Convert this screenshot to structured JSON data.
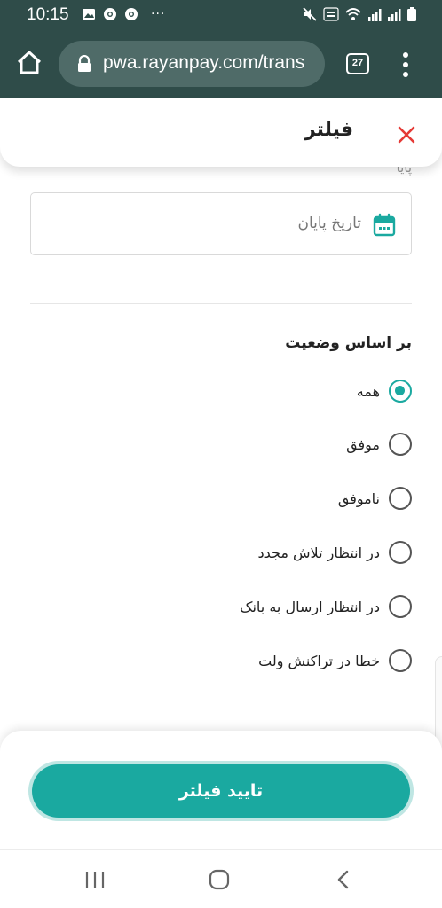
{
  "status_bar": {
    "time": "10:15",
    "left_icons": [
      "image-icon",
      "chrome-icon",
      "chrome-icon"
    ],
    "more": "···",
    "right_icons": [
      "mute-icon",
      "volte-icon",
      "wifi-icon",
      "signal-icon",
      "signal-icon",
      "battery-icon"
    ]
  },
  "browser": {
    "url": "pwa.rayanpay.com/trans",
    "tab_count": "27"
  },
  "header": {
    "title": "فیلتر",
    "peek_text": "پایا"
  },
  "date_field": {
    "placeholder": "تاریخ پایان"
  },
  "status_filter": {
    "title": "بر اساس وضعیت",
    "options": [
      {
        "label": "همه",
        "selected": true
      },
      {
        "label": "موفق",
        "selected": false
      },
      {
        "label": "ناموفق",
        "selected": false
      },
      {
        "label": "در انتظار تلاش مجدد",
        "selected": false
      },
      {
        "label": "در انتظار ارسال به بانک",
        "selected": false
      },
      {
        "label": "خطا در تراکنش ولت",
        "selected": false
      }
    ]
  },
  "footer": {
    "confirm_label": "تایید فیلتر"
  },
  "colors": {
    "accent": "#1aa9a0",
    "status_bar": "#2f4c49",
    "close": "#e53935"
  }
}
